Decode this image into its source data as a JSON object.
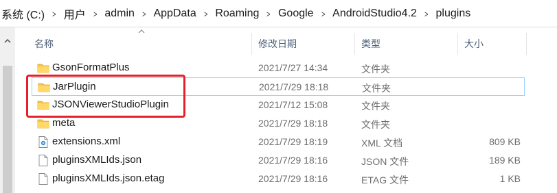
{
  "address_bar": {
    "breadcrumbs": [
      "系统 (C:)",
      "用户",
      "admin",
      "AppData",
      "Roaming",
      "Google",
      "AndroidStudio4.2",
      "plugins"
    ]
  },
  "columns": {
    "name": "名称",
    "date": "修改日期",
    "type": "类型",
    "size": "大小"
  },
  "files": [
    {
      "name": "GsonFormatPlus",
      "date": "2021/7/27 14:34",
      "type": "文件夹",
      "size": "",
      "icon": "folder-icon",
      "selected": false
    },
    {
      "name": "JarPlugin",
      "date": "2021/7/29 18:18",
      "type": "文件夹",
      "size": "",
      "icon": "folder-icon",
      "selected": true
    },
    {
      "name": "JSONViewerStudioPlugin",
      "date": "2021/7/12 15:08",
      "type": "文件夹",
      "size": "",
      "icon": "folder-icon",
      "selected": false
    },
    {
      "name": "meta",
      "date": "2021/7/29 18:18",
      "type": "文件夹",
      "size": "",
      "icon": "folder-icon",
      "selected": false
    },
    {
      "name": "extensions.xml",
      "date": "2021/7/29 18:19",
      "type": "XML 文档",
      "size": "809 KB",
      "icon": "xml-file-icon",
      "selected": false
    },
    {
      "name": "pluginsXMLIds.json",
      "date": "2021/7/29 18:16",
      "type": "JSON 文件",
      "size": "189 KB",
      "icon": "file-icon",
      "selected": false
    },
    {
      "name": "pluginsXMLIds.json.etag",
      "date": "2021/7/29 18:16",
      "type": "ETAG 文件",
      "size": "1 KB",
      "icon": "file-icon",
      "selected": false
    }
  ],
  "colors": {
    "highlight": "#e5202a",
    "selection_border": "#99d1ff",
    "folder": "#f5c44a",
    "header_text": "#4c607a"
  }
}
